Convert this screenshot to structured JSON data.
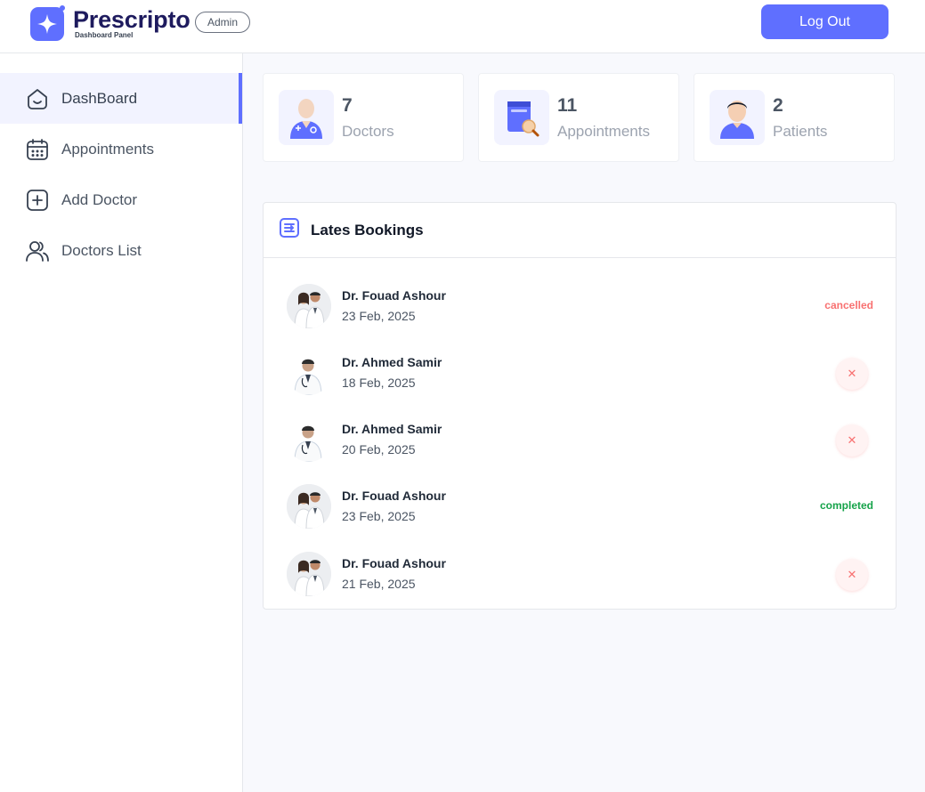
{
  "header": {
    "brand_name": "Prescripto",
    "brand_subtitle": "Dashboard Panel",
    "role_badge": "Admin",
    "logout_label": "Log Out"
  },
  "sidebar": {
    "items": [
      {
        "label": "DashBoard",
        "icon": "home-icon",
        "active": true
      },
      {
        "label": "Appointments",
        "icon": "calendar-icon",
        "active": false
      },
      {
        "label": "Add Doctor",
        "icon": "add-icon",
        "active": false
      },
      {
        "label": "Doctors List",
        "icon": "people-icon",
        "active": false
      }
    ]
  },
  "stats": [
    {
      "value": "7",
      "label": "Doctors",
      "icon": "doctor-icon"
    },
    {
      "value": "11",
      "label": "Appointments",
      "icon": "appointments-book-icon"
    },
    {
      "value": "2",
      "label": "Patients",
      "icon": "patient-icon"
    }
  ],
  "bookings": {
    "title": "Lates Bookings",
    "items": [
      {
        "doctor": "Dr. Fouad Ashour",
        "date": "23 Feb, 2025",
        "status": "cancelled",
        "status_label": "cancelled"
      },
      {
        "doctor": "Dr. Ahmed Samir",
        "date": "18 Feb, 2025",
        "status": "pending",
        "action_label": "✕"
      },
      {
        "doctor": "Dr. Ahmed Samir",
        "date": "20 Feb, 2025",
        "status": "pending",
        "action_label": "✕"
      },
      {
        "doctor": "Dr. Fouad Ashour",
        "date": "23 Feb, 2025",
        "status": "completed",
        "status_label": "completed"
      },
      {
        "doctor": "Dr. Fouad Ashour",
        "date": "21 Feb, 2025",
        "status": "pending",
        "action_label": "✕"
      }
    ]
  },
  "colors": {
    "primary": "#5f6fff",
    "brand_text": "#1e1b5e",
    "cancelled": "#f87171",
    "completed": "#16a34a",
    "active_nav_bg": "#f2f3ff"
  }
}
